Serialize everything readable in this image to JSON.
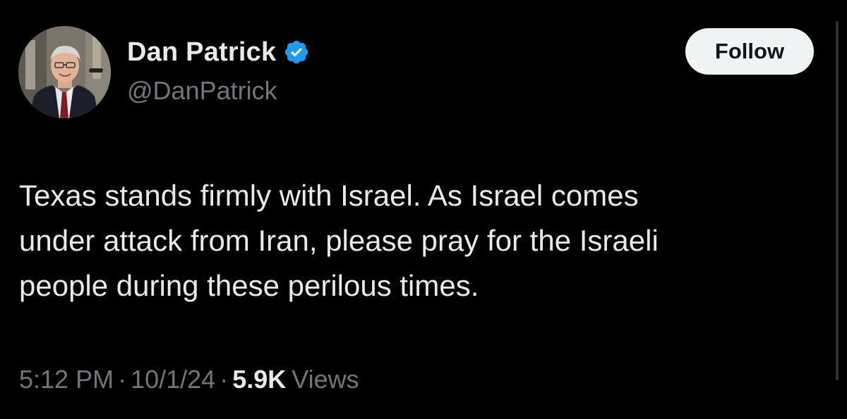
{
  "author": {
    "display_name": "Dan Patrick",
    "handle": "@DanPatrick",
    "verified": true,
    "verified_color": "#1d9bf0",
    "avatar_icon": "profile-photo"
  },
  "follow_button": {
    "label": "Follow"
  },
  "tweet": {
    "text_lines": [
      "Texas stands firmly with Israel. As Israel comes",
      "under attack from Iran, please pray for the Israeli",
      "people during these perilous times."
    ]
  },
  "meta": {
    "time": "5:12 PM",
    "separator": "·",
    "date": "10/1/24",
    "views_count": "5.9K",
    "views_label": "Views"
  },
  "colors": {
    "background": "#000000",
    "primary_text": "#e7e9ea",
    "secondary_text": "#71767b",
    "button_bg": "#eff3f4"
  }
}
